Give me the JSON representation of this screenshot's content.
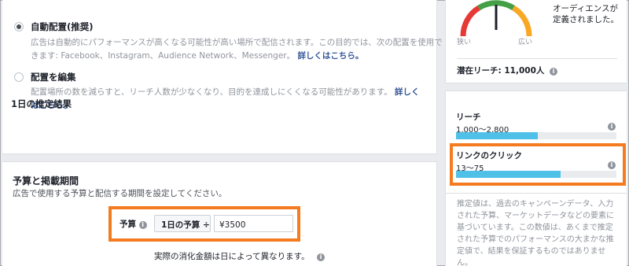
{
  "placements": {
    "auto": {
      "title": "自動配置(推奨)",
      "desc": "広告は自動的にパフォーマンスが高くなる可能性が高い場所で配信されます。この目的では、次の配置を使用できます: Facebook、Instagram、Audience Network、Messenger。",
      "link": "詳しくはこちら。",
      "selected": true
    },
    "edit": {
      "title": "配置を編集",
      "desc": "配置場所の数を減らすと、リーチ人数が少なくなり、目的を達成しにくくなる可能性があります。",
      "link": "詳しくはこちら。",
      "selected": false
    }
  },
  "budget_section": {
    "title": "予算と掲載期間",
    "subtitle": "広告で使用する予算と配信する期間を設定してください。",
    "budget_label": "予算",
    "budget_type": "1日の予算 ÷",
    "budget_value": "¥3500",
    "spend_note": "実際の消化金額は日によって異なります。"
  },
  "audience": {
    "note": "オーディエンスが定義されました。",
    "gauge_narrow": "狭い",
    "gauge_wide": "広い",
    "potential_reach": "潜在リーチ: 11,000人"
  },
  "daily_estimate": {
    "title": "1日の推定結果",
    "reach": {
      "name": "リーチ",
      "range": "1,000〜2,800",
      "fill": 0.51
    },
    "clicks": {
      "name": "リンクのクリック",
      "range": "13〜75",
      "fill": 0.65
    }
  },
  "estimate_note": "推定値は、過去のキャンペーンデータ、入力された予算、マーケットデータなどの要素に基づいています。この数値は、あくまで推定された予算でのパフォーマンスの大まかな推定値で、結果を保証するものではありません。",
  "colors": {
    "highlight": "#f47b20",
    "bar": "#4fc0e8",
    "link": "#365899"
  },
  "icons": {
    "info": "i"
  }
}
